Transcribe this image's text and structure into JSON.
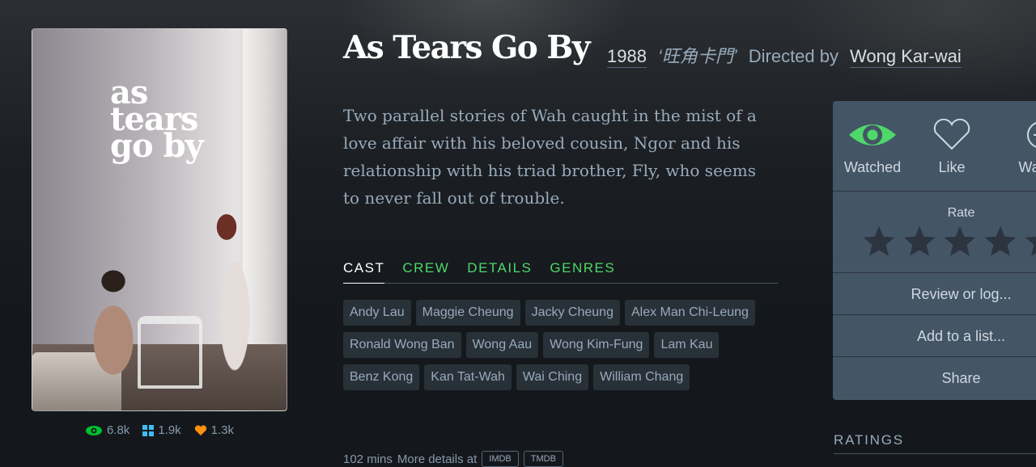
{
  "film": {
    "title": "As Tears Go By",
    "year": "1988",
    "original_title": "‘旺角卡門’",
    "directed_by_label": "Directed by",
    "director": "Wong Kar-wai",
    "synopsis": "Two parallel stories of Wah caught in the mist of a love affair with his beloved cousin, Ngor and his relationship with his triad brother, Fly, who seems to never fall out of trouble."
  },
  "poster": {
    "title_lines": [
      "as",
      "tears",
      "go by"
    ]
  },
  "stats": {
    "watched": "6.8k",
    "lists": "1.9k",
    "likes": "1.3k"
  },
  "tabs": [
    {
      "label": "CAST",
      "active": true
    },
    {
      "label": "CREW",
      "active": false
    },
    {
      "label": "DETAILS",
      "active": false
    },
    {
      "label": "GENRES",
      "active": false
    }
  ],
  "cast": [
    "Andy Lau",
    "Maggie Cheung",
    "Jacky Cheung",
    "Alex Man Chi-Leung",
    "Ronald Wong Ban",
    "Wong Aau",
    "Wong Kim-Fung",
    "Lam Kau",
    "Benz Kong",
    "Kan Tat-Wah",
    "Wai Ching",
    "William Chang"
  ],
  "footer": {
    "runtime": "102 mins",
    "more_details": "More details at",
    "imdb": "IMDB",
    "tmdb": "TMDB"
  },
  "panel": {
    "watched_label": "Watched",
    "like_label": "Like",
    "watchlist_label": "Wat",
    "rate_label": "Rate",
    "stars": 5,
    "review_label": "Review or log...",
    "add_list_label": "Add to a list...",
    "share_label": "Share"
  },
  "sections": {
    "ratings": "RATINGS"
  },
  "colors": {
    "background": "#14181c",
    "watched_green": "#40bcf4",
    "accent_green": "#4ed86a",
    "panel": "#456",
    "like_orange": "#ff9010"
  }
}
